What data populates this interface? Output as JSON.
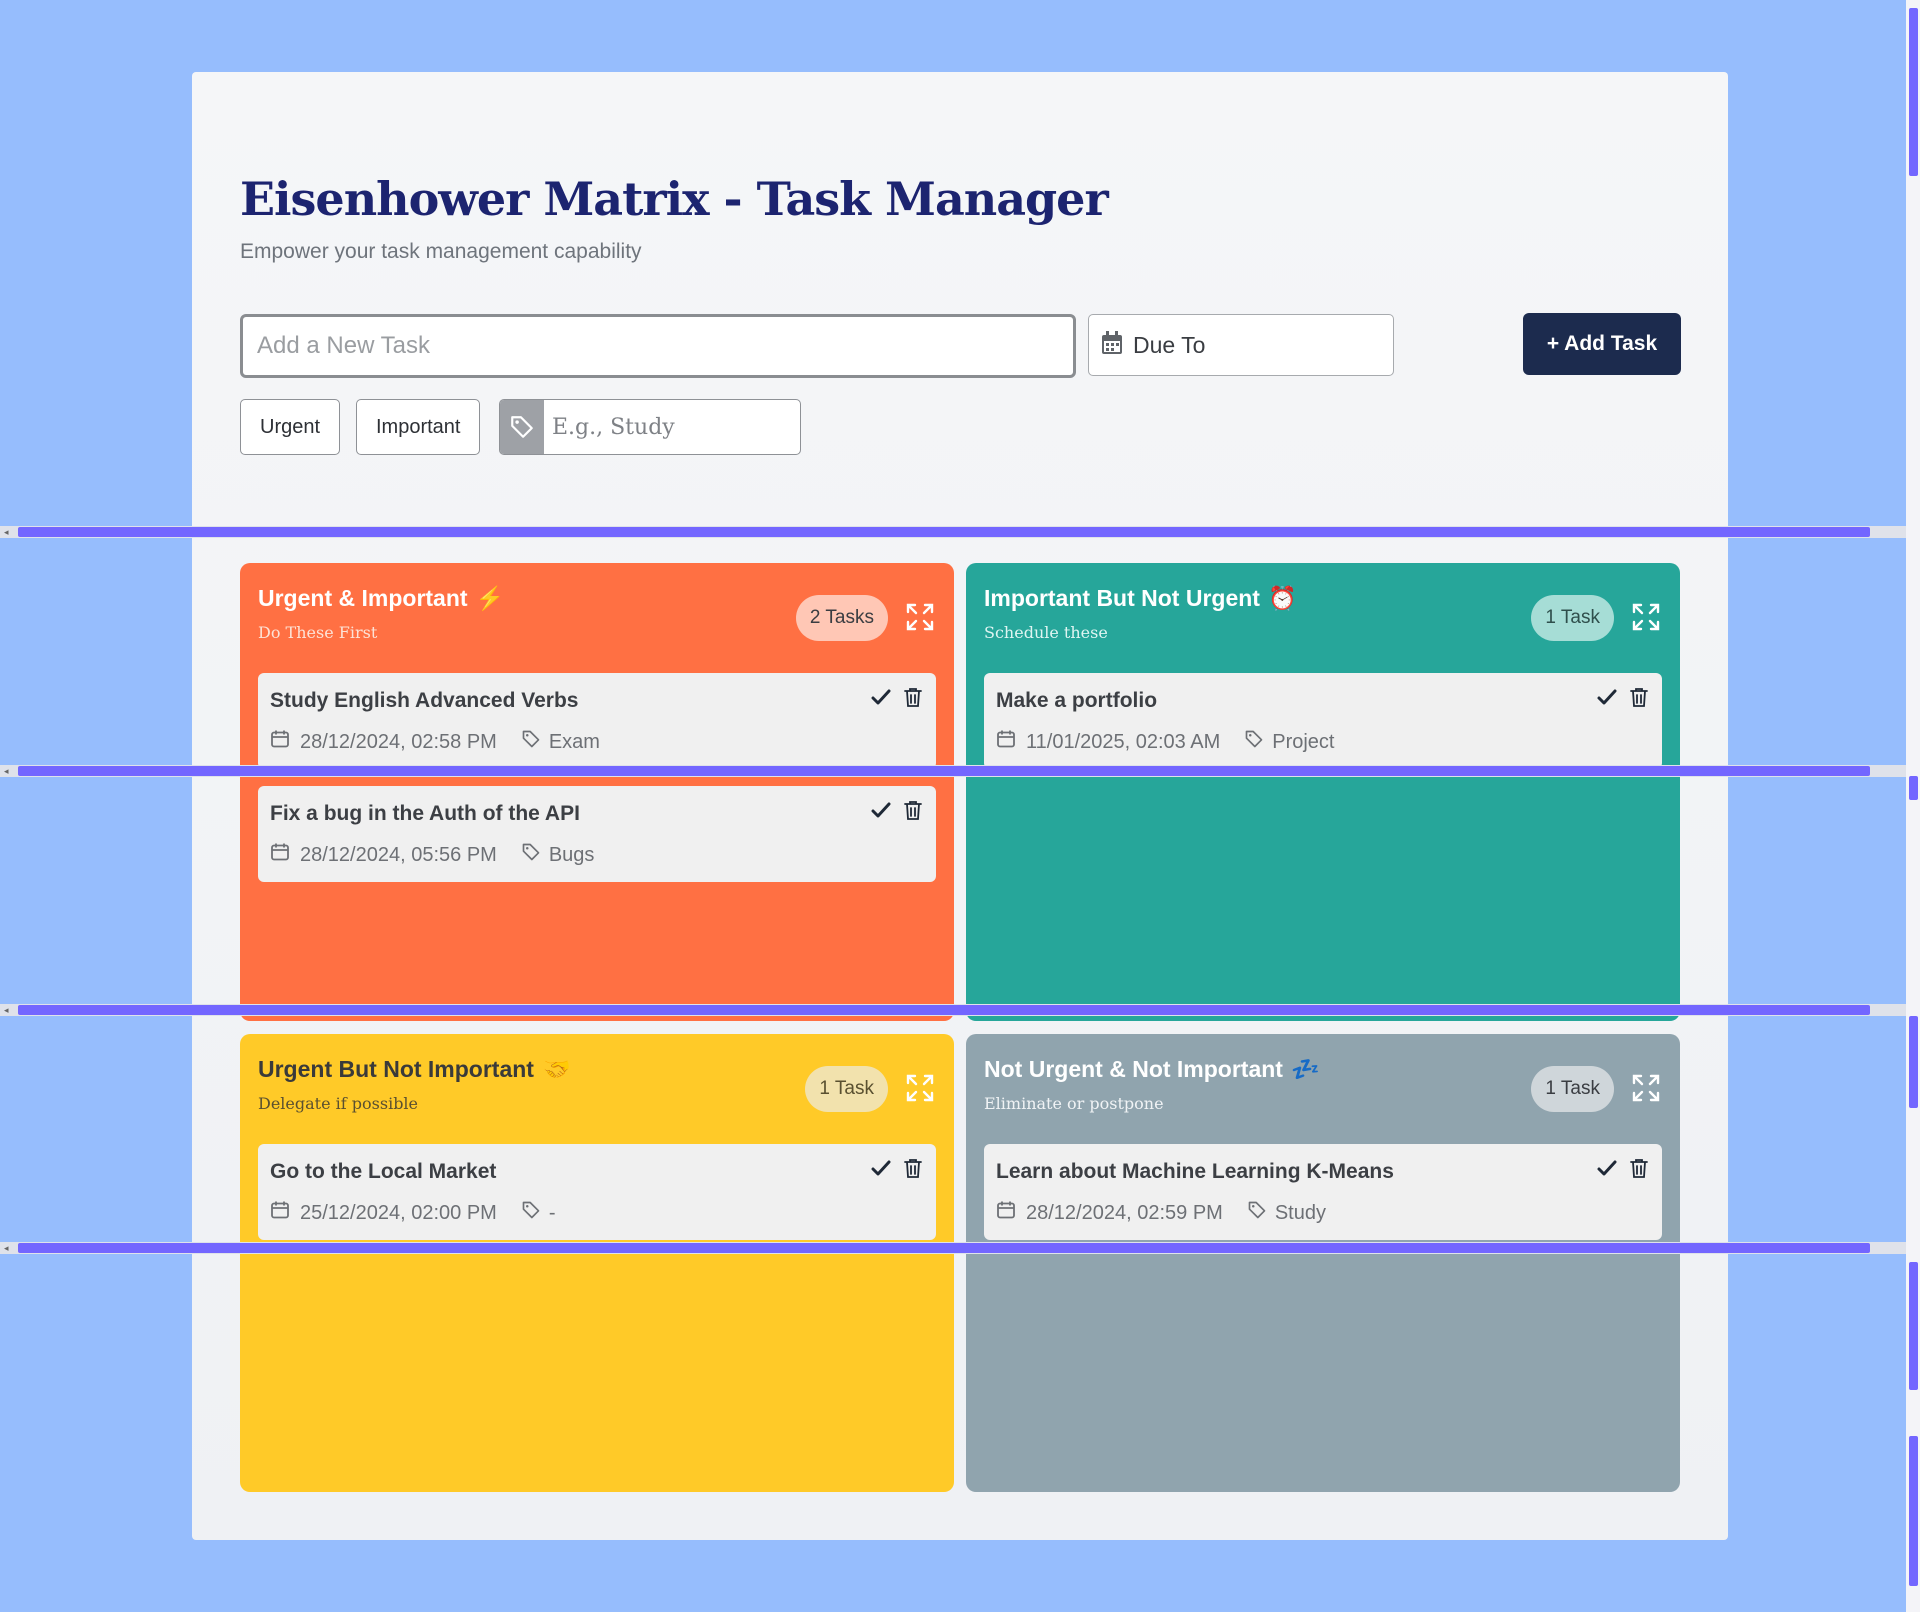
{
  "header": {
    "title": "Eisenhower Matrix - Task Manager",
    "subtitle": "Empower your task management capability"
  },
  "form": {
    "task_placeholder": "Add a New Task",
    "due_label": "Due To",
    "add_button": "+ Add Task",
    "urgent_label": "Urgent",
    "important_label": "Important",
    "tag_placeholder": "E.g., Study"
  },
  "quadrants": [
    {
      "name": "Urgent & Important",
      "emoji": "⚡",
      "subtitle": "Do These First",
      "count": "2 Tasks",
      "color": "#ff7043",
      "tasks": [
        {
          "title": "Study English Advanced Verbs",
          "date": "28/12/2024, 02:58 PM",
          "tag": "Exam"
        },
        {
          "title": "Fix a bug in the Auth of the API",
          "date": "28/12/2024, 05:56 PM",
          "tag": "Bugs"
        }
      ]
    },
    {
      "name": "Important But Not Urgent",
      "emoji": "⏰",
      "subtitle": "Schedule these",
      "count": "1 Task",
      "color": "#26a69a",
      "tasks": [
        {
          "title": "Make a portfolio",
          "date": "11/01/2025, 02:03 AM",
          "tag": "Project"
        }
      ]
    },
    {
      "name": "Urgent But Not Important",
      "emoji": "🤝",
      "subtitle": "Delegate if possible",
      "count": "1 Task",
      "color": "#ffca28",
      "tasks": [
        {
          "title": "Go to the Local Market",
          "date": "25/12/2024, 02:00 PM",
          "tag": "-"
        }
      ]
    },
    {
      "name": "Not Urgent & Not Important",
      "emoji": "💤",
      "subtitle": "Eliminate or postpone",
      "count": "1 Task",
      "color": "#90a4ae",
      "tasks": [
        {
          "title": "Learn about Machine Learning K-Means",
          "date": "28/12/2024, 02:59 PM",
          "tag": "Study"
        }
      ]
    }
  ],
  "icons": {
    "due": "calendar-icon",
    "tag": "tag-icon",
    "expand": "expand-icon",
    "complete": "check-icon",
    "delete": "trash-icon"
  }
}
